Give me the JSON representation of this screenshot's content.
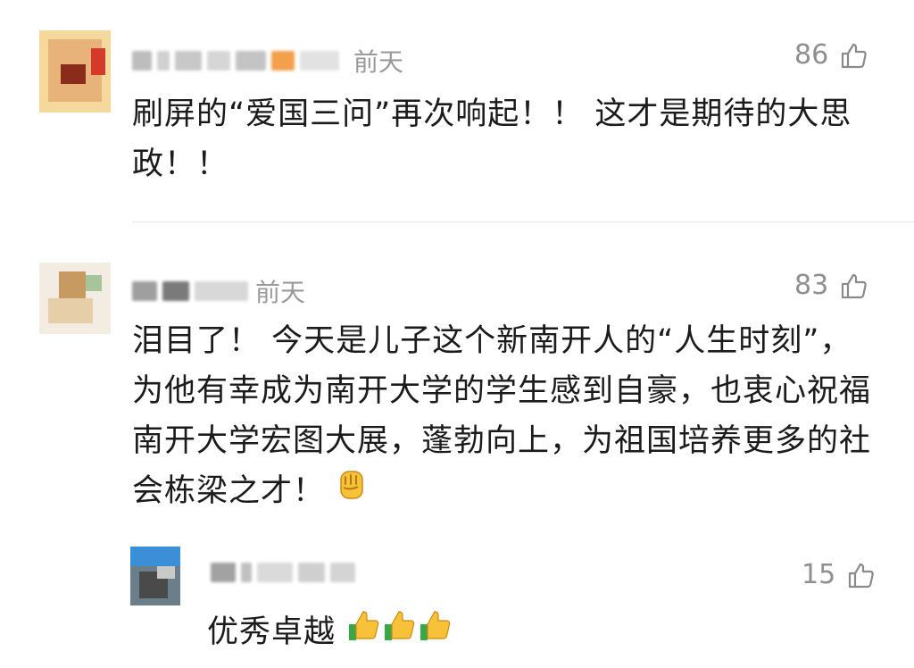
{
  "comments": [
    {
      "time": "前天",
      "likes": "86",
      "text": "刷屏的“爱国三问”再次响起！！ 这才是期待的大思政！！"
    },
    {
      "time": "前天",
      "likes": "83",
      "text": "泪目了！ 今天是儿子这个新南开人的“人生时刻”，为他有幸成为南开大学的学生感到自豪，也衷心祝福南开大学宏图大展，蓬勃向上，为祖国培养更多的社会栋梁之才！",
      "emoji": "raised-fist-icon"
    }
  ],
  "reply": {
    "likes": "15",
    "text": "优秀卓越",
    "emojis": [
      "thumbs-up-icon",
      "thumbs-up-icon",
      "thumbs-up-icon"
    ]
  },
  "colors": {
    "text": "#1b1b1b",
    "muted": "#9a9a9a",
    "divider": "#e6e6e6"
  }
}
